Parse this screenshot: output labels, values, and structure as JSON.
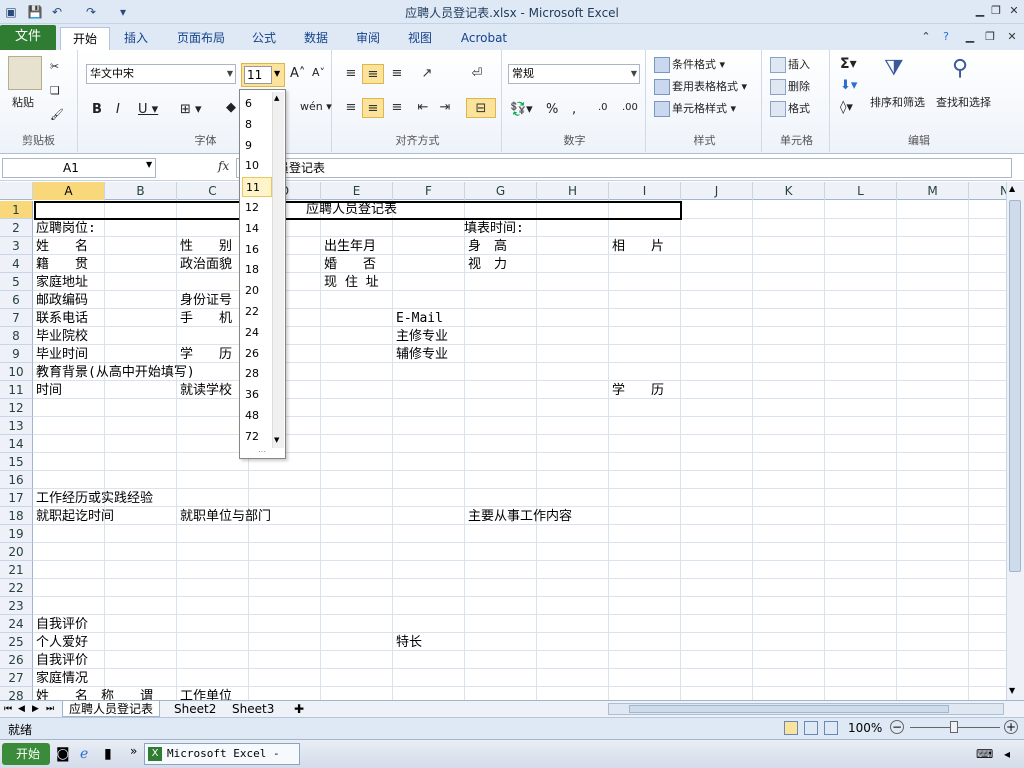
{
  "window": {
    "title": "应聘人员登记表.xlsx - Microsoft Excel"
  },
  "tabs": {
    "file": "文件",
    "items": [
      "开始",
      "插入",
      "页面布局",
      "公式",
      "数据",
      "审阅",
      "视图",
      "Acrobat"
    ]
  },
  "ribbon": {
    "clipboard": {
      "label": "剪贴板",
      "paste": "粘贴"
    },
    "font": {
      "label": "字体",
      "name": "华文中宋",
      "size": "11"
    },
    "align": {
      "label": "对齐方式"
    },
    "number": {
      "label": "数字",
      "format": "常规"
    },
    "styles": {
      "label": "样式",
      "cond": "条件格式",
      "table": "套用表格格式",
      "cell": "单元格样式"
    },
    "cells": {
      "label": "单元格",
      "insert": "插入",
      "delete": "删除",
      "format": "格式"
    },
    "edit": {
      "label": "编辑",
      "sort": "排序和筛选",
      "find": "查找和选择"
    }
  },
  "formula": {
    "namebox": "A1",
    "fx": "fx",
    "value": "应聘人员登记表"
  },
  "font_size_list": [
    "6",
    "8",
    "9",
    "10",
    "11",
    "12",
    "14",
    "16",
    "18",
    "20",
    "22",
    "24",
    "26",
    "28",
    "36",
    "48",
    "72"
  ],
  "columns": [
    "A",
    "B",
    "C",
    "D",
    "E",
    "F",
    "G",
    "H",
    "I",
    "J",
    "K",
    "L",
    "M",
    "N"
  ],
  "rows": [
    "1",
    "2",
    "3",
    "4",
    "5",
    "6",
    "7",
    "8",
    "9",
    "10",
    "11",
    "12",
    "13",
    "14",
    "15",
    "16",
    "17",
    "18",
    "19",
    "20",
    "21",
    "22",
    "23",
    "24",
    "25",
    "26",
    "27",
    "28"
  ],
  "cells": {
    "title": "应聘人员登记表",
    "r2a": "应聘岗位:",
    "r2g": "填表时间:",
    "r3a": "姓　　名",
    "r3c": "性　　别",
    "r3e": "出生年月",
    "r3g": "身　高",
    "r3i": "相　　片",
    "r4a": "籍　　贯",
    "r4c": "政治面貌",
    "r4e": "婚　　否",
    "r4g": "视　力",
    "r5a": "家庭地址",
    "r5e": "现 住 址",
    "r6a": "邮政编码",
    "r6c": "身份证号",
    "r7a": "联系电话",
    "r7c": "手　　机",
    "r7f": "E-Mail",
    "r8a": "毕业院校",
    "r8f": "主修专业",
    "r9a": "毕业时间",
    "r9c": "学　　历",
    "r9f": "辅修专业",
    "r10a": "教育背景(从高中开始填写)",
    "r11a": "时间",
    "r11c": "就读学校",
    "r11i": "学　　历",
    "r17a": "工作经历或实践经验",
    "r18a": "就职起讫时间",
    "r18c": "就职单位与部门",
    "r18g": "主要从事工作内容",
    "r24a": "自我评价",
    "r25a": "个人爱好",
    "r25f": "特长",
    "r26a": "自我评价",
    "r27a": "家庭情况",
    "r28a": "姓　　名　称　　谓",
    "r28c": "工作单位"
  },
  "sheets": [
    "应聘人员登记表",
    "Sheet2",
    "Sheet3"
  ],
  "status": {
    "ready": "就绪",
    "zoom": "100%"
  },
  "taskbar": {
    "start": "开始",
    "app": "Microsoft Excel - ..."
  }
}
